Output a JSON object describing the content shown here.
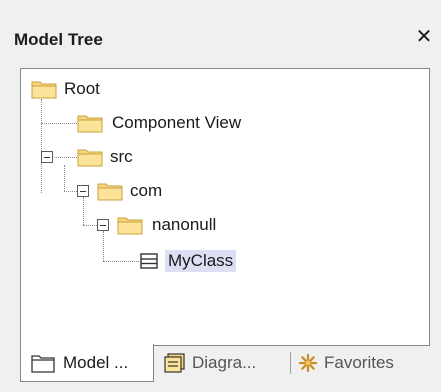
{
  "panel": {
    "title": "Model Tree",
    "close_glyph": "✕"
  },
  "tree": {
    "nodes": [
      {
        "label": "Root",
        "icon": "folder-icon",
        "expanded": true
      },
      {
        "label": "Component View",
        "icon": "folder-icon"
      },
      {
        "label": "src",
        "icon": "folder-icon",
        "expanded": true
      },
      {
        "label": "com",
        "icon": "folder-icon",
        "expanded": true
      },
      {
        "label": "nanonull",
        "icon": "folder-icon",
        "expanded": true
      },
      {
        "label": "MyClass",
        "icon": "class-icon",
        "selected": true
      }
    ]
  },
  "tabs": [
    {
      "label": "Model ...",
      "icon": "folder-icon",
      "active": true
    },
    {
      "label": "Diagra...",
      "icon": "diagram-icon"
    },
    {
      "label": "Favorites",
      "icon": "favorites-icon"
    }
  ],
  "colors": {
    "selection": "#dde0f5",
    "folder": "#f7d77a",
    "favorites": "#c8902a"
  }
}
